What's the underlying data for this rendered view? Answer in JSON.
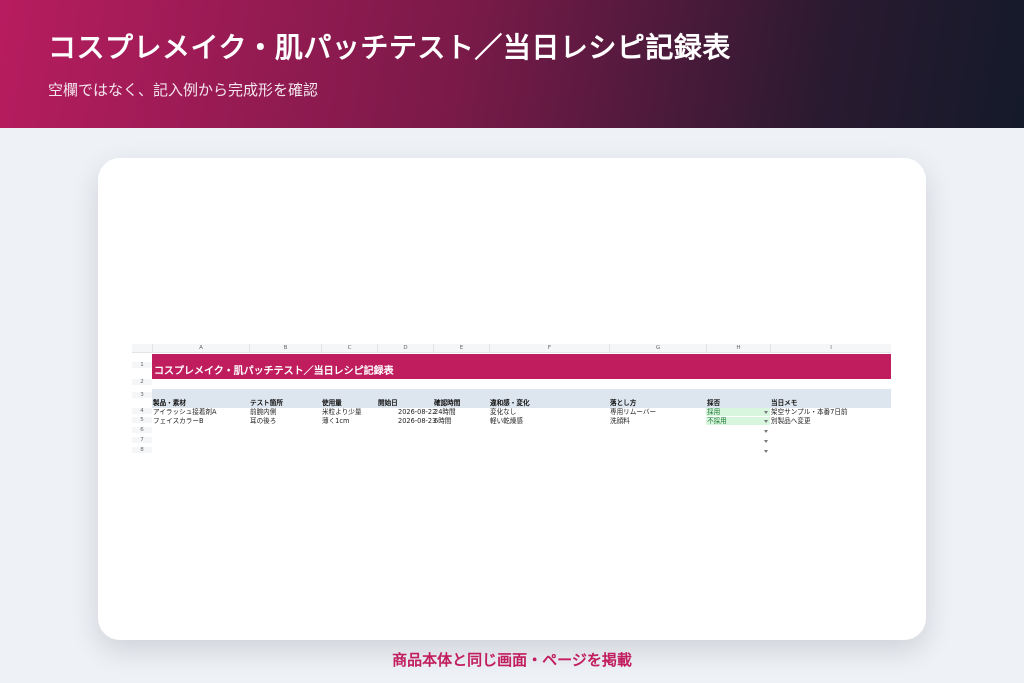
{
  "header": {
    "title": "コスプレメイク・肌パッチテスト／当日レシピ記録表",
    "subtitle": "空欄ではなく、記入例から完成形を確認"
  },
  "spreadsheet": {
    "columns": [
      "A",
      "B",
      "C",
      "D",
      "E",
      "F",
      "G",
      "H",
      "I"
    ],
    "row_numbers": [
      "1",
      "2",
      "3",
      "4",
      "5",
      "6",
      "7",
      "8"
    ],
    "title": "コスプレメイク・肌パッチテスト／当日レシピ記録表",
    "headers": [
      "製品・素材",
      "テスト箇所",
      "使用量",
      "開始日",
      "確認時間",
      "違和感・変化",
      "落とし方",
      "採否",
      "当日メモ"
    ],
    "rows": [
      [
        "アイラッシュ接着剤A",
        "前腕内側",
        "米粒より少量",
        "2026-08-22",
        "24時間",
        "変化なし",
        "専用リムーバー",
        "採用",
        "架空サンプル・本番7日前"
      ],
      [
        "フェイスカラーB",
        "耳の後ろ",
        "薄く1cm",
        "2026-08-23",
        "6時間",
        "軽い乾燥感",
        "洗顔料",
        "不採用",
        "別製品へ変更"
      ]
    ]
  },
  "caption": "商品本体と同じ画面・ページを掲載",
  "colors": {
    "accent": "#bf1d5e",
    "header_band": "#dde5ee",
    "dropdown_fill": "#d8f5dd"
  }
}
